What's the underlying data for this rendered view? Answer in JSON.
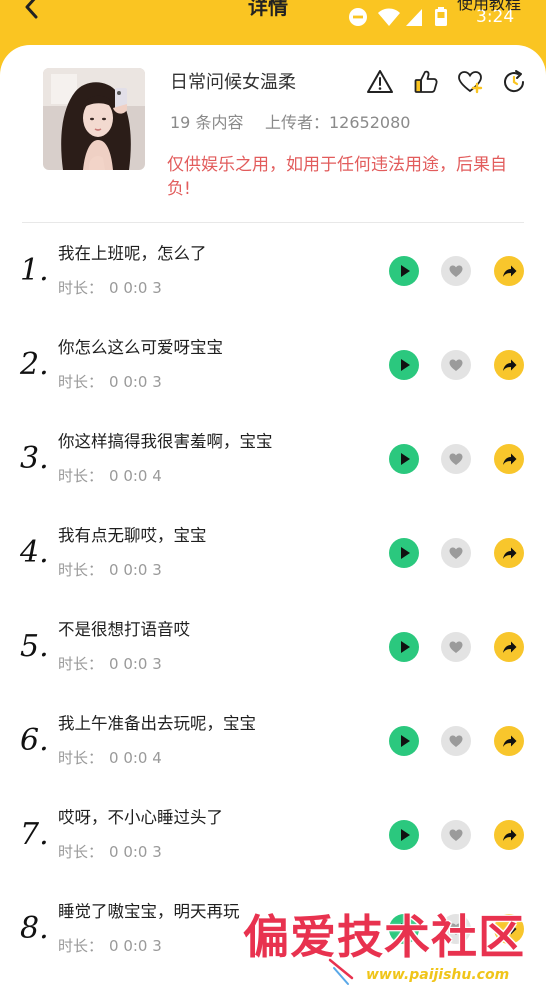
{
  "status_bar": {
    "time": "3:24",
    "icons": [
      "dnd-icon",
      "wifi-icon",
      "signal-icon",
      "battery-icon"
    ]
  },
  "header": {
    "back_icon": "chevron-left-icon",
    "title": "详情",
    "help_link": "使用教程"
  },
  "pack": {
    "avatar": "avatar-photo",
    "title": "日常问候女温柔",
    "count": "19 条内容",
    "uploader": "上传者：12652080",
    "disclaimer": "仅供娱乐之用，如用于任何违法用途，后果自负!",
    "actions": [
      "warning-icon",
      "thumbs-up-icon",
      "heart-add-icon",
      "refresh-icon"
    ]
  },
  "item_duration_label": "时长：",
  "item_actions": [
    "play-icon",
    "heart-icon",
    "share-icon"
  ],
  "items": [
    {
      "index": "1.",
      "text": "我在上班呢，怎么了",
      "duration": "0 0:0 3"
    },
    {
      "index": "2.",
      "text": "你怎么这么可爱呀宝宝",
      "duration": "0 0:0 3"
    },
    {
      "index": "3.",
      "text": "你这样搞得我很害羞啊，宝宝",
      "duration": "0 0:0 4"
    },
    {
      "index": "4.",
      "text": "我有点无聊哎，宝宝",
      "duration": "0 0:0 3"
    },
    {
      "index": "5.",
      "text": "不是很想打语音哎",
      "duration": "0 0:0 3"
    },
    {
      "index": "6.",
      "text": "我上午准备出去玩呢，宝宝",
      "duration": "0 0:0 4"
    },
    {
      "index": "7.",
      "text": "哎呀，不小心睡过头了",
      "duration": "0 0:0 3"
    },
    {
      "index": "8.",
      "text": "睡觉了嗷宝宝，明天再玩",
      "duration": "0 0:0 3"
    }
  ],
  "colors": {
    "header": "#fac522",
    "play": "#2bc87e",
    "like": "#e3e3e3",
    "share": "#f8c62c",
    "disclaimer": "#e25c5c"
  },
  "watermark": {
    "text": "偏爱技术社区",
    "url": "www.paijishu.com"
  }
}
